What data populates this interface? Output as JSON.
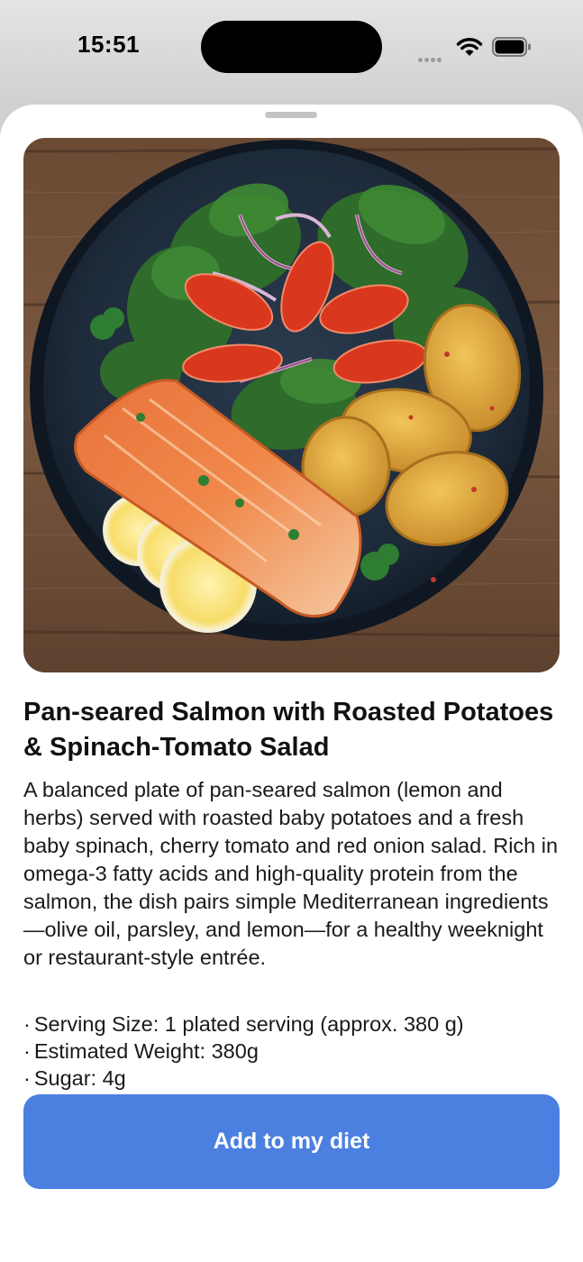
{
  "status_bar": {
    "time": "15:51",
    "icons": [
      "cellular-dots-icon",
      "wifi-icon",
      "battery-icon"
    ]
  },
  "food_detail": {
    "image_alt": "Pan-seared salmon with lemon slices, roasted potatoes and spinach-tomato salad on a dark plate",
    "title": "Pan-seared Salmon with Roasted Potatoes & Spinach-Tomato Salad",
    "description": "A balanced plate of pan-seared salmon (lemon and herbs) served with roasted baby potatoes and a fresh baby spinach, cherry tomato and red onion salad. Rich in omega-3 fatty acids and high-quality protein from the salmon, the dish pairs simple Mediterranean ingredients—olive oil, parsley, and lemon—for a healthy weeknight or restaurant-style entrée.",
    "bullet": "·",
    "facts": [
      "Serving Size: 1 plated serving (approx. 380 g)",
      "Estimated Weight: 380g",
      "Sugar: 4g"
    ]
  },
  "actions": {
    "add_label": "Add to my diet"
  },
  "colors": {
    "accent": "#4b7fe0",
    "sheet_background": "#ffffff",
    "backdrop": "#c9cacb"
  }
}
